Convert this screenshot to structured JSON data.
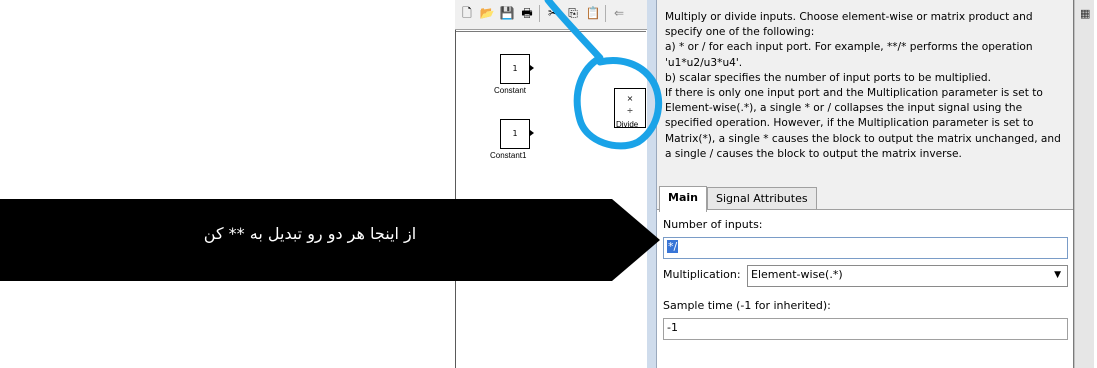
{
  "toolbar": {
    "icons": [
      "new-icon",
      "open-icon",
      "save-icon",
      "print-icon",
      "cut-icon",
      "copy-icon",
      "paste-icon",
      "back-icon"
    ]
  },
  "model": {
    "blocks": [
      {
        "label": "Constant",
        "value": "1"
      },
      {
        "label": "Constant1",
        "value": "1"
      },
      {
        "label": "Divide",
        "ops": [
          "×",
          "÷"
        ]
      }
    ]
  },
  "dialog": {
    "description_lines": [
      "Multiply or divide inputs.  Choose element-wise or matrix product and",
      "specify one of the following:",
      " a) * or / for each input port. For example, **/* performs the operation",
      "'u1*u2/u3*u4'.",
      " b) scalar specifies the number of input ports to be multiplied.",
      "If there is only one input port and the Multiplication parameter is set to",
      "Element-wise(.*), a single * or / collapses the input signal using the",
      "specified operation. However, if the Multiplication parameter is set to",
      "Matrix(*), a single * causes the block to output the matrix unchanged, and",
      "a single / causes the block to output the matrix inverse."
    ],
    "tabs": [
      {
        "label": "Main",
        "active": true
      },
      {
        "label": "Signal Attributes",
        "active": false
      }
    ],
    "number_of_inputs_label": "Number of inputs:",
    "number_of_inputs_value": "*/",
    "multiplication_label": "Multiplication:",
    "multiplication_value": "Element-wise(.*)",
    "sample_time_label": "Sample time (-1 for inherited):",
    "sample_time_value": "-1"
  },
  "annotation": {
    "text": "از اینجا هر دو رو تبدیل به ** کن",
    "callout_color": "#000000",
    "marker_color": "#1aa3e8"
  },
  "accent_color": "#3875d7"
}
